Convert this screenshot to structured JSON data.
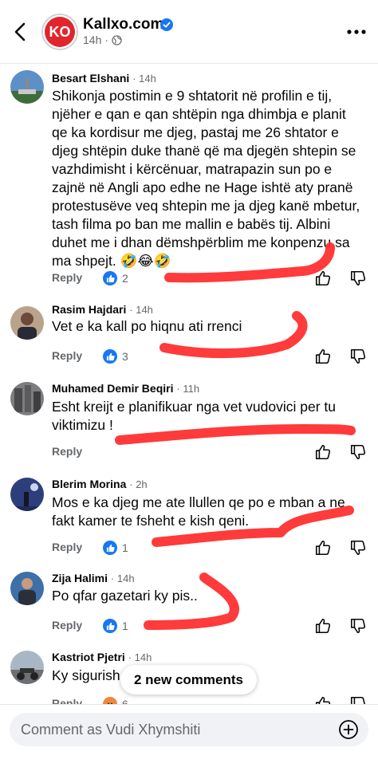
{
  "header": {
    "page_name": "Kallxo.com",
    "logo_text": "KO",
    "time": "14h",
    "icons": {
      "back": "chevron-left-icon",
      "verified": "verified-badge-icon",
      "audience": "globe-icon",
      "more": "more-horizontal-icon"
    },
    "colors": {
      "brand": "#e1252c",
      "verified": "#1877f2"
    }
  },
  "comments": [
    {
      "author": "Besart Elshani",
      "time": "14h",
      "text": "Shikonja postimin e 9 shtatorit në profilin e tij, njëher e qan e qan shtëpin nga dhimbja e planit qe ka kordisur me djeg, pastaj me 26 shtator e djeg shtëpin duke thanë që ma djegën shtepin se vazhdimisht i kërcënuar, matrapazin sun po e zajnë në Angli apo edhe ne Hage ishtë aty pranë protestusëve veq shtepin me ja djeg kanë mbetur, tash filma po ban me mallin e babës tij. Albini duhet me i dhan dëmshpërblim me konpenzu sa ma shpejt. 🤣😂🤣",
      "reply": "Reply",
      "reaction_count": "2",
      "reaction": "like"
    },
    {
      "author": "Rasim Hajdari",
      "time": "14h",
      "text": "Vet e ka kall po hiqnu ati rrenci",
      "reply": "Reply",
      "reaction_count": "3",
      "reaction": "like"
    },
    {
      "author": "Muhamed Demir Beqiri",
      "time": "11h",
      "text": "Esht kreijt e planifikuar nga vet vudovici per tu viktimizu !",
      "reply": "Reply",
      "reaction_count": "",
      "reaction": "none"
    },
    {
      "author": "Blerim Morina",
      "time": "2h",
      "text": "Mos e ka djeg me ate llullen qe po e mban a ne fakt kamer te fsheht e kish qeni.",
      "reply": "Reply",
      "reaction_count": "1",
      "reaction": "like"
    },
    {
      "author": "Zija Halimi",
      "time": "14h",
      "text": "Po qfar gazetari ky pis..",
      "reply": "Reply",
      "reaction_count": "1",
      "reaction": "like"
    },
    {
      "author": "Kastriot Pjetri",
      "time": "14h",
      "text": "Ky sigurish",
      "reply": "Reply",
      "reaction_count": "6",
      "reaction": "angry"
    }
  ],
  "new_comments_label": "2 new comments",
  "composer": {
    "placeholder": "Comment as Vudi Xhymshiti",
    "icon": "plus-circle-icon"
  },
  "annotation_color": "#ff2a2a"
}
